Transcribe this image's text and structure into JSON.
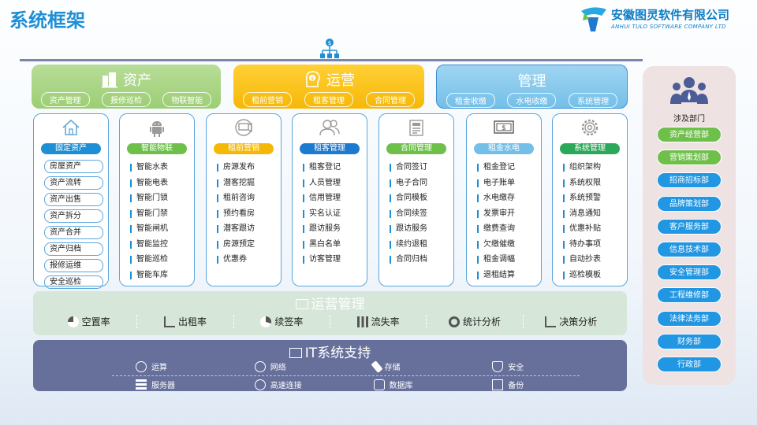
{
  "page": {
    "title": "系统框架"
  },
  "logo": {
    "name_cn": "安徽图灵软件有限公司",
    "name_en": "ANHUI TULO SOFTWARE COMPANY LTD"
  },
  "categories": [
    {
      "title": "资产",
      "tags": [
        "资产管理",
        "报修巡检",
        "物联智能"
      ]
    },
    {
      "title": "运营",
      "tags": [
        "租前营销",
        "租客管理",
        "合同管理"
      ]
    },
    {
      "title": "管理",
      "tags": [
        "租金收缴",
        "水电收缴",
        "系统管理"
      ]
    }
  ],
  "modules": [
    {
      "header": "固定资产",
      "color": "#1e8fd5",
      "items": [
        "房屋资产",
        "资产流转",
        "资产出售",
        "资产拆分",
        "资产合并",
        "资产归档",
        "报修运维",
        "安全巡检"
      ]
    },
    {
      "header": "智能物联",
      "color": "#6fc04b",
      "items": [
        "智能水表",
        "智能电表",
        "智能门锁",
        "智能门禁",
        "智能闸机",
        "智能监控",
        "智能巡检",
        "智能车库"
      ]
    },
    {
      "header": "租前营销",
      "color": "#f6b808",
      "items": [
        "房源发布",
        "潜客挖掘",
        "租前咨询",
        "预约看房",
        "潜客跟访",
        "房源预定",
        "优惠券"
      ]
    },
    {
      "header": "租客管理",
      "color": "#1e7ad0",
      "items": [
        "租客登记",
        "人员管理",
        "信用管理",
        "实名认证",
        "跟访服务",
        "黑白名单",
        "访客管理"
      ]
    },
    {
      "header": "合同管理",
      "color": "#6fc04b",
      "items": [
        "合同签订",
        "电子合同",
        "合同模板",
        "合同续签",
        "跟访服务",
        "续约退租",
        "合同归档"
      ]
    },
    {
      "header": "租金水电",
      "color": "#74bfe8",
      "items": [
        "租金登记",
        "电子账单",
        "水电缴存",
        "发票审开",
        "缴费查询",
        "欠缴催缴",
        "租金调幅",
        "退租结算"
      ]
    },
    {
      "header": "系统管理",
      "color": "#2ca85a",
      "items": [
        "组织架构",
        "系统权限",
        "系统预警",
        "消息通知",
        "优惠补贴",
        "待办事项",
        "自动抄表",
        "巡检模板"
      ]
    }
  ],
  "operations": {
    "title": "运营管理",
    "items": [
      "空置率",
      "出租率",
      "续签率",
      "流失率",
      "统计分析",
      "决策分析"
    ]
  },
  "it_support": {
    "title": "IT系统支持",
    "items": [
      "运算",
      "网络",
      "存储",
      "安全",
      "服务器",
      "高速连接",
      "数据库",
      "备份"
    ]
  },
  "departments": {
    "title": "涉及部门",
    "items": [
      {
        "label": "资产经营部",
        "color": "green"
      },
      {
        "label": "营销策划部",
        "color": "green"
      },
      {
        "label": "招商招标部",
        "color": "blue"
      },
      {
        "label": "品牌策划部",
        "color": "blue"
      },
      {
        "label": "客户服务部",
        "color": "blue"
      },
      {
        "label": "信息技术部",
        "color": "blue"
      },
      {
        "label": "安全管理部",
        "color": "blue"
      },
      {
        "label": "工程维修部",
        "color": "blue"
      },
      {
        "label": "法律法务部",
        "color": "blue"
      },
      {
        "label": "财务部",
        "color": "blue"
      },
      {
        "label": "行政部",
        "color": "blue"
      }
    ]
  },
  "icons": [
    "network-icon",
    "building-icon",
    "money-head-icon",
    "home-icon",
    "android-icon",
    "megaphone-icon",
    "users-icon",
    "document-icon",
    "banknote-icon",
    "gear-icon",
    "department-people-icon"
  ]
}
